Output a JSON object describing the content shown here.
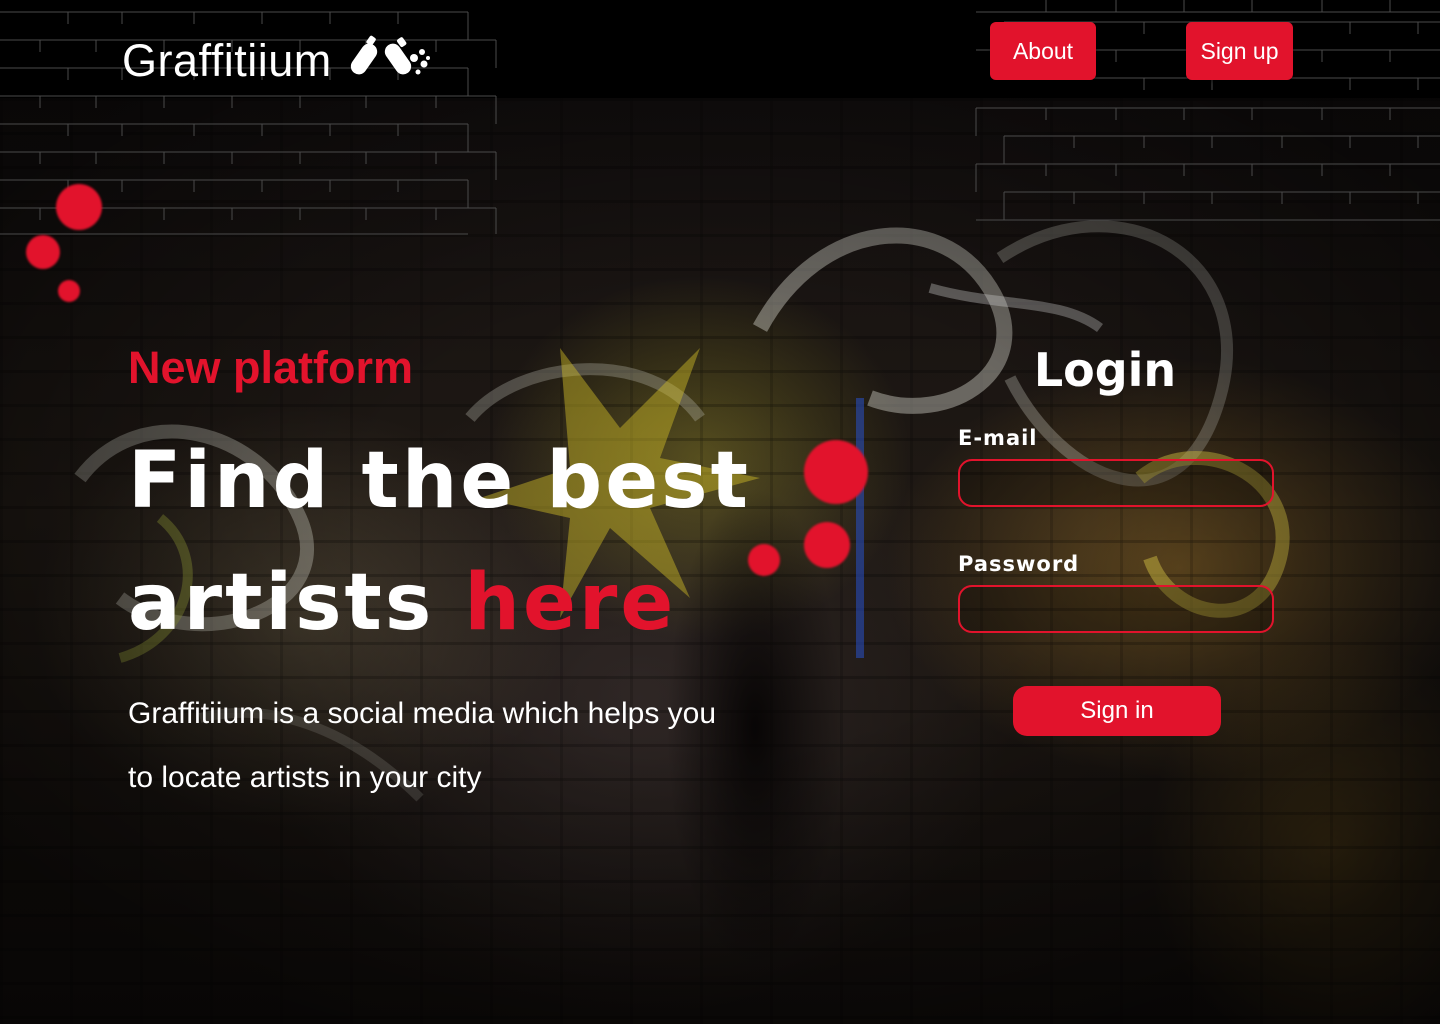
{
  "header": {
    "brand": "Graffitiium",
    "nav": {
      "about_label": "About",
      "signup_label": "Sign up"
    }
  },
  "hero": {
    "tagline": "New platform",
    "headline_line1": "Find the best",
    "headline_line2_white": "artists",
    "headline_line2_accent": "here",
    "description": "Graffitiium is a social media which helps you to locate artists in your city"
  },
  "login": {
    "title": "Login",
    "email_label": "E-mail",
    "email_value": "",
    "password_label": "Password",
    "password_value": "",
    "submit_label": "Sign in"
  },
  "colors": {
    "accent": "#e2132c",
    "header_bg": "#000000",
    "text": "#ffffff"
  },
  "icons": [
    "spray-can-icon"
  ]
}
